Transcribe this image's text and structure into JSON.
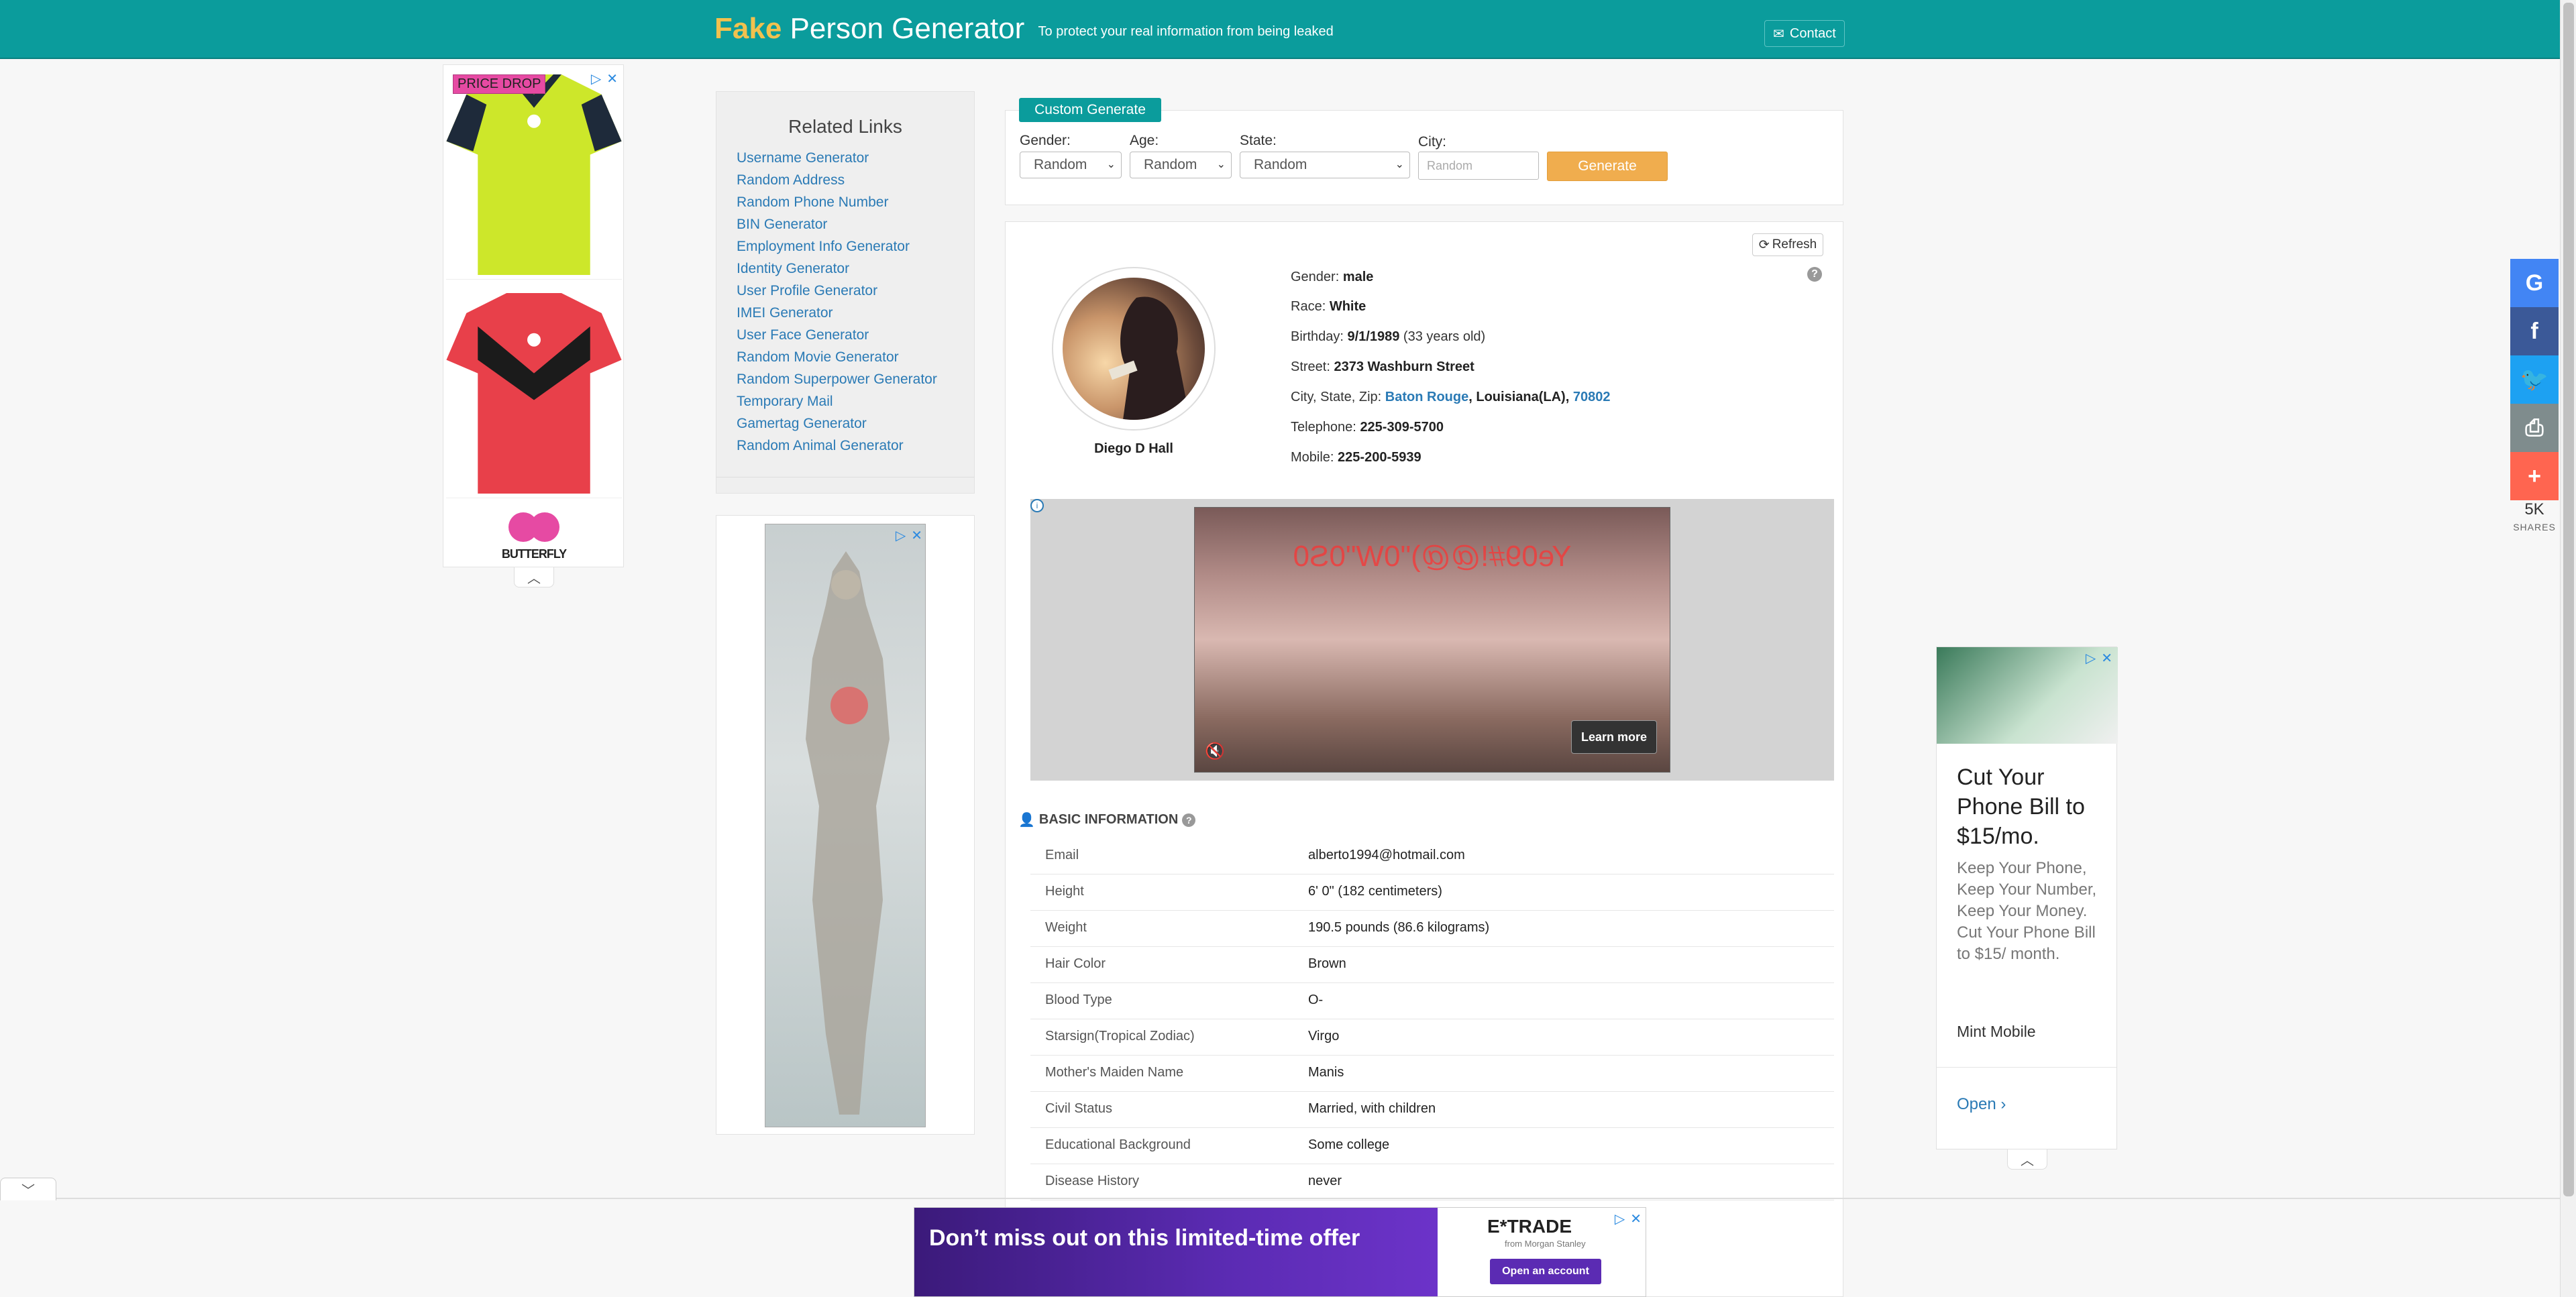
{
  "header": {
    "brand_fake": "Fake",
    "brand_rest": "Person Generator",
    "tagline": "To protect your real information from being leaked",
    "contact_label": "Contact"
  },
  "left_ad": {
    "price_drop": "PRICE DROP",
    "brand": "BUTTERFLY",
    "colors": {
      "shirt1": "#cde72a",
      "shirt2": "#e8404a"
    }
  },
  "related": {
    "title": "Related Links",
    "links": [
      "Username Generator",
      "Random Address",
      "Random Phone Number",
      "BIN Generator",
      "Employment Info Generator",
      "Identity Generator",
      "User Profile Generator",
      "IMEI Generator",
      "User Face Generator",
      "Random Movie Generator",
      "Random Superpower Generator",
      "Temporary Mail",
      "Gamertag Generator",
      "Random Animal Generator"
    ]
  },
  "generate": {
    "tab_label": "Custom Generate",
    "gender_label": "Gender:",
    "gender_value": "Random",
    "age_label": "Age:",
    "age_value": "Random",
    "state_label": "State:",
    "state_value": "Random",
    "city_label": "City:",
    "city_placeholder": "Random",
    "button_label": "Generate"
  },
  "person": {
    "refresh_label": "Refresh",
    "name": "Diego D Hall",
    "gender_label": "Gender:",
    "gender": "male",
    "race_label": "Race:",
    "race": "White",
    "birthday_label": "Birthday:",
    "birthday": "9/1/1989",
    "age_text": "(33 years old)",
    "street_label": "Street:",
    "street": "2373 Washburn Street",
    "csz_label": "City, State, Zip:",
    "city": "Baton Rouge",
    "state": "Louisiana(LA)",
    "zip": "70802",
    "telephone_label": "Telephone:",
    "telephone": "225-309-5700",
    "mobile_label": "Mobile:",
    "mobile": "225-200-5939"
  },
  "video_ad": {
    "overlay_text": "Ye09#!@@)\"0W\"0S0",
    "learn_more": "Learn more"
  },
  "basic_info": {
    "title": "BASIC INFORMATION",
    "rows": [
      {
        "k": "Email",
        "v": "alberto1994@hotmail.com"
      },
      {
        "k": "Height",
        "v": "6' 0\" (182 centimeters)"
      },
      {
        "k": "Weight",
        "v": "190.5 pounds (86.6 kilograms)"
      },
      {
        "k": "Hair Color",
        "v": "Brown"
      },
      {
        "k": "Blood Type",
        "v": "O-"
      },
      {
        "k": "Starsign(Tropical Zodiac)",
        "v": "Virgo"
      },
      {
        "k": "Mother's Maiden Name",
        "v": "Manis"
      },
      {
        "k": "Civil Status",
        "v": "Married, with children"
      },
      {
        "k": "Educational Background",
        "v": "Some college"
      },
      {
        "k": "Disease History",
        "v": "never"
      }
    ]
  },
  "share": {
    "count": "5K",
    "label": "SHARES",
    "colors": {
      "google": "#4285f4",
      "facebook": "#3b5998",
      "twitter": "#1da1f2",
      "print": "#7f8c8d",
      "more": "#ff6550"
    }
  },
  "right_ad": {
    "headline": "Cut Your Phone Bill to $15/mo.",
    "body": "Keep Your Phone, Keep Your Number, Keep Your Money. Cut Your Phone Bill to $15/ month.",
    "brand": "Mint Mobile",
    "open_label": "Open"
  },
  "bottom_ad": {
    "headline": "Don’t miss out on this limited-time offer",
    "logo": "E*TRADE",
    "sub": "from Morgan Stanley",
    "button": "Open an account"
  },
  "theme": {
    "primary": "#0b9c9c",
    "accent": "#f0ad4e",
    "link": "#2a7ab5"
  }
}
